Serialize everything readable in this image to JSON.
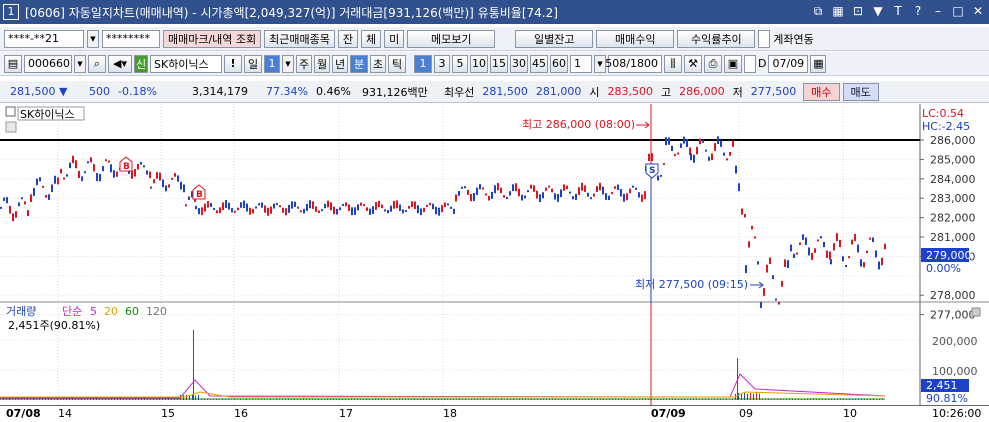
{
  "window": {
    "number": "1",
    "title": "[0606] 자동일지차트(매매내역) - 시가총액[2,049,327(억)] 거래대금[931,126(백만)] 유통비율[74.2]",
    "icons": [
      "restore-icon",
      "tile-icon",
      "copy-icon",
      "pin-icon",
      "text-icon",
      "help-icon",
      "minimize-icon",
      "maximize-icon",
      "close-icon"
    ]
  },
  "toolbar1": {
    "account": "****-**21",
    "password": "********",
    "trade_mark_btn": "매매마크/내역 조회",
    "recent_btn": "최근매매종목",
    "jan": "잔",
    "che": "체",
    "mi": "미",
    "memo_btn": "메모보기",
    "daily_balance_btn": "일별잔고",
    "trade_profit_btn": "매매수익",
    "profit_trend_btn": "수익률추이",
    "account_link_label": "계좌연동"
  },
  "toolbar2": {
    "code": "000660",
    "market_badge": "신",
    "stock_name": "SK하이닉스",
    "excl": "!",
    "period": "일",
    "period_count": "1",
    "week": "주",
    "month": "월",
    "year": "년",
    "minute": "분",
    "second": "초",
    "tick": "틱",
    "intervals": [
      "1",
      "3",
      "5",
      "10",
      "15",
      "30",
      "45",
      "60"
    ],
    "interval_custom": "1",
    "data_count": "508",
    "data_total": "/1800",
    "d_label": "D",
    "date": "07/09"
  },
  "quote": {
    "price": "281,500",
    "arrow": "▼",
    "change": "500",
    "change_pct": "-0.18%",
    "volume": "3,314,179",
    "vol_ratio": "77.34%",
    "rate": "0.46%",
    "amount": "931,126백만",
    "best_label": "최우선",
    "best_ask": "281,500",
    "best_bid": "281,000",
    "open_label": "시",
    "open": "283,500",
    "high_label": "고",
    "high": "286,000",
    "low_label": "저",
    "low": "277,500",
    "buy_btn": "매수",
    "sell_btn": "매도"
  },
  "price_chart": {
    "legend_name": "SK하이닉스",
    "lc_label": "LC:0.54",
    "hc_label": "HC:-2.45",
    "max_annotation": "최고 286,000 (08:00)",
    "min_annotation": "최저 277,500 (09:15)",
    "y_ticks": [
      "286,000",
      "285,000",
      "284,000",
      "283,000",
      "282,000",
      "281,000",
      "280,000",
      "279,000",
      "278,000",
      "277,000"
    ],
    "current_price_tag": "279,000",
    "current_pct_tag": "0.00%",
    "buy_marker": "B",
    "sell_marker": "S"
  },
  "volume_chart": {
    "title": "거래량",
    "ma_label": "단순",
    "ma5": "5",
    "ma20": "20",
    "ma60": "60",
    "ma120": "120",
    "current_value": "2,451주(90.81%)",
    "y_ticks": [
      "200,000",
      "100,000"
    ],
    "current_tag": "2,451",
    "pct_tag": "90.81%"
  },
  "x_axis": {
    "labels": [
      "07/08",
      "14",
      "15",
      "16",
      "17",
      "18",
      "07/09",
      "09",
      "10"
    ],
    "time": "10:26:00"
  },
  "colors": {
    "title_bar": "#31518e",
    "up": "#e0141e",
    "down": "#1c41c6",
    "ma5": "#d020d0",
    "ma20": "#e0a000",
    "ma60": "#0a8a0a",
    "ma120": "#777777"
  }
}
